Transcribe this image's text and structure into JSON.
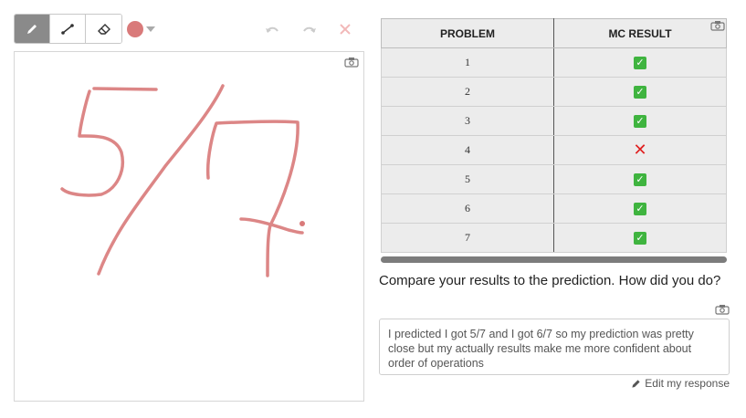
{
  "toolbar": {
    "tools": [
      {
        "name": "pencil-icon",
        "active": true
      },
      {
        "name": "line-icon",
        "active": false
      },
      {
        "name": "eraser-icon",
        "active": false
      }
    ],
    "color": "#d97a7a",
    "undo_icon": "undo-icon",
    "redo_icon": "redo-icon",
    "clear_icon": "close-icon"
  },
  "table": {
    "headers": [
      "PROBLEM",
      "MC RESULT"
    ],
    "rows": [
      {
        "problem": "1",
        "result": "correct"
      },
      {
        "problem": "2",
        "result": "correct"
      },
      {
        "problem": "3",
        "result": "correct"
      },
      {
        "problem": "4",
        "result": "incorrect"
      },
      {
        "problem": "5",
        "result": "correct"
      },
      {
        "problem": "6",
        "result": "correct"
      },
      {
        "problem": "7",
        "result": "correct"
      }
    ]
  },
  "question": "Compare your results to the prediction.  How did you do?",
  "response": "I predicted I got 5/7 and I got 6/7 so my prediction was pretty close but my actually results make me more confident about order of operations",
  "edit_label": "Edit my response",
  "colors": {
    "correct": "#3fb43f",
    "incorrect": "#e02020",
    "ink": "#d97a7a"
  }
}
